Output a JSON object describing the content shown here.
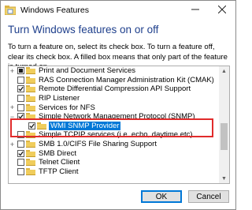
{
  "window": {
    "title": "Windows Features",
    "controls": {
      "minimize_icon": "minimize-icon",
      "close_icon": "close-icon"
    }
  },
  "heading": "Turn Windows features on or off",
  "description": "To turn a feature on, select its check box. To turn a feature off, clear its check box. A filled box means that only part of the feature is turned on.",
  "features": [
    {
      "label": "Print and Document Services",
      "state": "partial",
      "expandable": true
    },
    {
      "label": "RAS Connection Manager Administration Kit (CMAK)",
      "state": "unchecked",
      "expandable": false
    },
    {
      "label": "Remote Differential Compression API Support",
      "state": "checked",
      "expandable": false
    },
    {
      "label": "RIP Listener",
      "state": "unchecked",
      "expandable": false
    },
    {
      "label": "Services for NFS",
      "state": "unchecked",
      "expandable": true
    },
    {
      "label": "Simple Network Management Protocol (SNMP)",
      "state": "checked",
      "expandable": true,
      "expanded": true
    },
    {
      "label": "WMI SNMP Provider",
      "state": "checked",
      "child": true,
      "selected": true
    },
    {
      "label": "Simple TCPIP services (i.e. echo, daytime etc)",
      "state": "unchecked",
      "expandable": false
    },
    {
      "label": "SMB 1.0/CIFS File Sharing Support",
      "state": "unchecked",
      "expandable": true
    },
    {
      "label": "SMB Direct",
      "state": "checked",
      "expandable": false
    },
    {
      "label": "Telnet Client",
      "state": "unchecked",
      "expandable": false
    },
    {
      "label": "TFTP Client",
      "state": "unchecked",
      "expandable": false
    }
  ],
  "buttons": {
    "ok": "OK",
    "cancel": "Cancel"
  },
  "colors": {
    "heading": "#1e3f8c",
    "selection": "#0078d7",
    "highlight": "#e12b2b"
  }
}
